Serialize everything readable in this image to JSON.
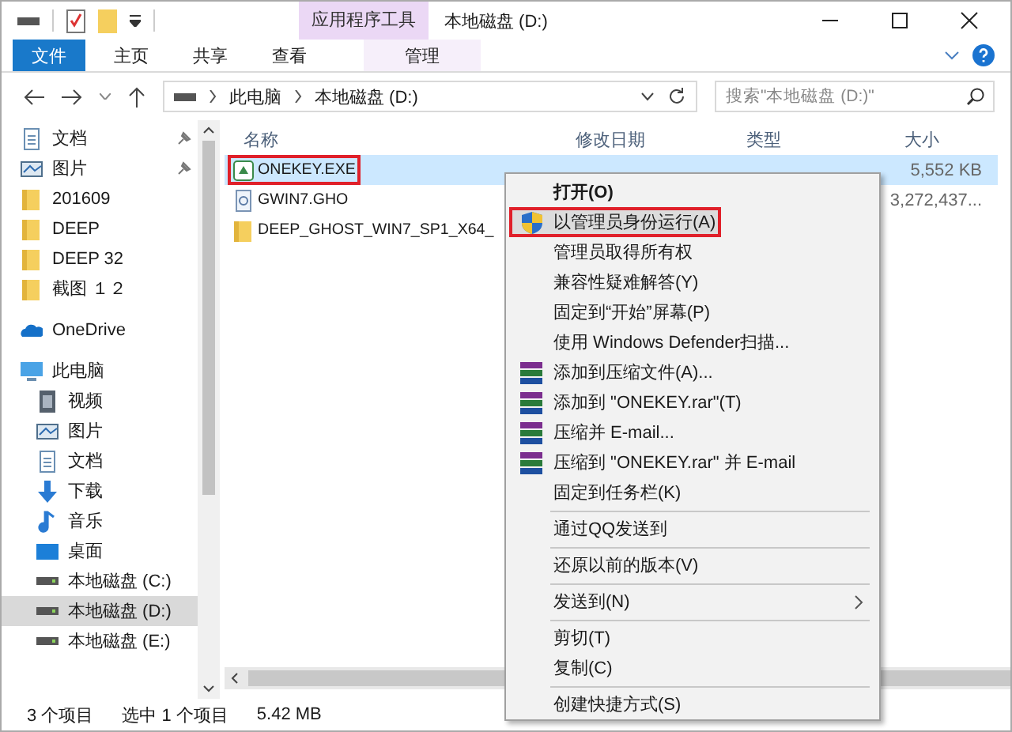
{
  "window": {
    "title": "本地磁盘 (D:)"
  },
  "contextual_tab": {
    "group": "应用程序工具",
    "tab": "管理"
  },
  "ribbon_tabs": [
    {
      "label": "文件",
      "kind": "file"
    },
    {
      "label": "主页",
      "kind": "tab"
    },
    {
      "label": "共享",
      "kind": "tab"
    },
    {
      "label": "查看",
      "kind": "tab"
    }
  ],
  "address": {
    "path": [
      "此电脑",
      "本地磁盘 (D:)"
    ]
  },
  "search": {
    "placeholder": "搜索\"本地磁盘 (D:)\""
  },
  "quick_access": [
    {
      "label": "文档",
      "kind": "document",
      "pinned": true
    },
    {
      "label": "图片",
      "kind": "picture",
      "pinned": true
    },
    {
      "label": "201609",
      "kind": "folder",
      "pinned": false
    },
    {
      "label": "DEEP",
      "kind": "folder",
      "pinned": false
    },
    {
      "label": "DEEP 32",
      "kind": "folder",
      "pinned": false
    },
    {
      "label": "截图 １２",
      "kind": "folder",
      "pinned": false
    }
  ],
  "onedrive": {
    "label": "OneDrive"
  },
  "this_pc": {
    "label": "此电脑",
    "children": [
      {
        "label": "视频",
        "kind": "video",
        "selected": false
      },
      {
        "label": "图片",
        "kind": "picture",
        "selected": false
      },
      {
        "label": "文档",
        "kind": "document",
        "selected": false
      },
      {
        "label": "下载",
        "kind": "download",
        "selected": false
      },
      {
        "label": "音乐",
        "kind": "music",
        "selected": false
      },
      {
        "label": "桌面",
        "kind": "desktop",
        "selected": false
      },
      {
        "label": "本地磁盘 (C:)",
        "kind": "drive",
        "selected": false
      },
      {
        "label": "本地磁盘 (D:)",
        "kind": "drive",
        "selected": true
      },
      {
        "label": "本地磁盘 (E:)",
        "kind": "drive",
        "selected": false
      }
    ]
  },
  "columns": [
    "名称",
    "修改日期",
    "类型",
    "大小"
  ],
  "files": [
    {
      "name": "ONEKEY.EXE",
      "size": "5,552 KB",
      "kind": "exe",
      "selected": true,
      "outlined": true
    },
    {
      "name": "GWIN7.GHO",
      "size": "3,272,437...",
      "kind": "ghost",
      "selected": false,
      "outlined": false
    },
    {
      "name": "DEEP_GHOST_WIN7_SP1_X64_",
      "kind": "folder",
      "selected": false,
      "outlined": false
    }
  ],
  "context_menu": [
    {
      "kind": "plain",
      "label": "打开(O)",
      "bold": true,
      "selected": false,
      "outlined": false
    },
    {
      "kind": "shield",
      "label": "以管理员身份运行(A)",
      "bold": false,
      "selected": true,
      "outlined": true
    },
    {
      "kind": "plain",
      "label": "管理员取得所有权",
      "bold": false,
      "selected": false,
      "outlined": false
    },
    {
      "kind": "plain",
      "label": "兼容性疑难解答(Y)",
      "bold": false,
      "selected": false,
      "outlined": false
    },
    {
      "kind": "plain",
      "label": "固定到“开始”屏幕(P)",
      "bold": false,
      "selected": false,
      "outlined": false
    },
    {
      "kind": "plain",
      "label": "使用 Windows Defender扫描...",
      "bold": false,
      "selected": false,
      "outlined": false
    },
    {
      "kind": "archive",
      "label": "添加到压缩文件(A)...",
      "bold": false,
      "selected": false,
      "outlined": false
    },
    {
      "kind": "archive",
      "label": "添加到 \"ONEKEY.rar\"(T)",
      "bold": false,
      "selected": false,
      "outlined": false
    },
    {
      "kind": "archive",
      "label": "压缩并 E-mail...",
      "bold": false,
      "selected": false,
      "outlined": false
    },
    {
      "kind": "archive",
      "label": "压缩到 \"ONEKEY.rar\" 并 E-mail",
      "bold": false,
      "selected": false,
      "outlined": false
    },
    {
      "kind": "plain",
      "label": "固定到任务栏(K)",
      "bold": false,
      "selected": false,
      "outlined": false
    },
    {
      "kind": "separator"
    },
    {
      "kind": "plain",
      "label": "通过QQ发送到",
      "bold": false,
      "selected": false,
      "outlined": false
    },
    {
      "kind": "separator"
    },
    {
      "kind": "plain",
      "label": "还原以前的版本(V)",
      "bold": false,
      "selected": false,
      "outlined": false
    },
    {
      "kind": "separator"
    },
    {
      "kind": "submenu",
      "label": "发送到(N)",
      "bold": false,
      "selected": false,
      "outlined": false
    },
    {
      "kind": "separator"
    },
    {
      "kind": "plain",
      "label": "剪切(T)",
      "bold": false,
      "selected": false,
      "outlined": false
    },
    {
      "kind": "plain",
      "label": "复制(C)",
      "bold": false,
      "selected": false,
      "outlined": false
    },
    {
      "kind": "separator"
    },
    {
      "kind": "plain",
      "label": "创建快捷方式(S)",
      "bold": false,
      "selected": false,
      "outlined": false
    }
  ],
  "status_bar": {
    "count": "3 个项目",
    "selection": "选中 1 个项目",
    "size": "5.42 MB"
  }
}
